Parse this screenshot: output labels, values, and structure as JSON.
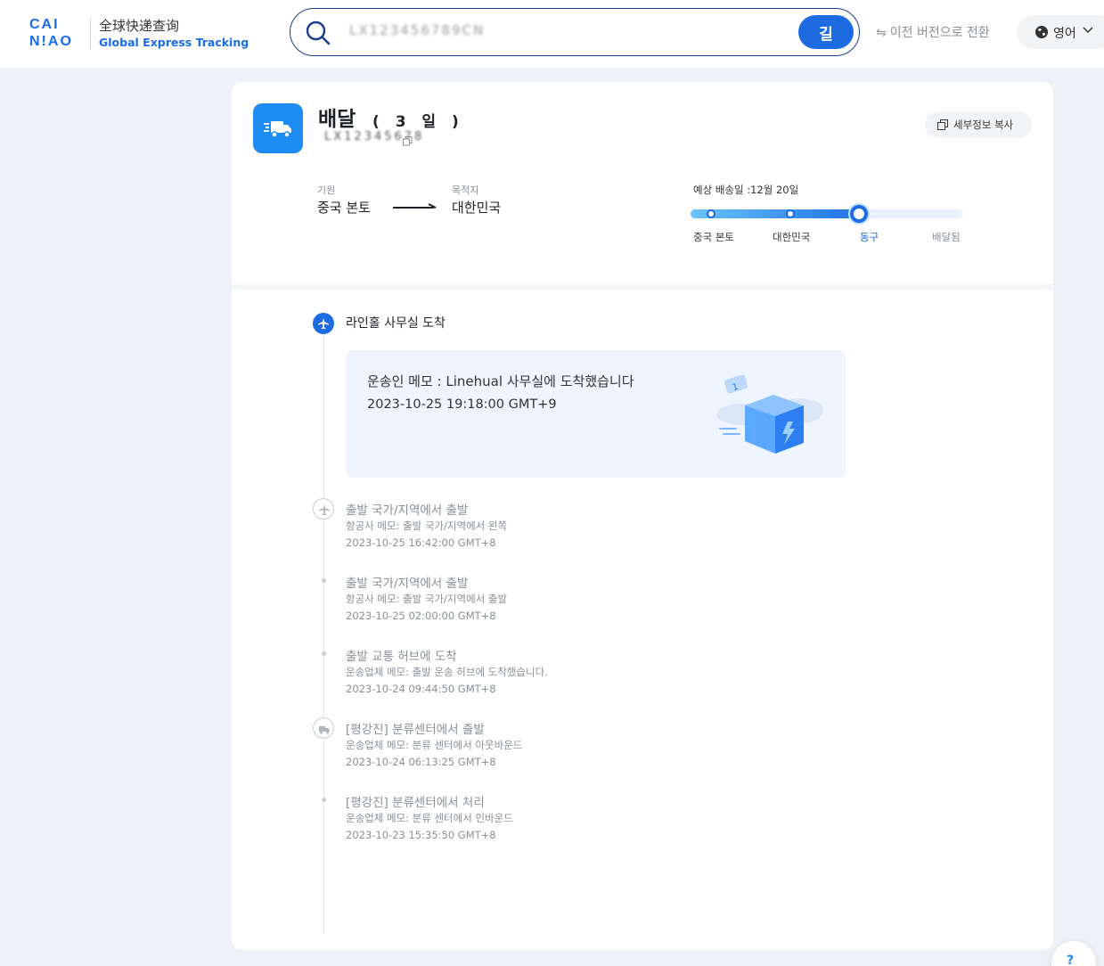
{
  "header": {
    "logo_cn": "全球快递查询",
    "logo_en": "Global Express Tracking",
    "search": {
      "value": "LX123456789CN",
      "button": "길"
    },
    "switch_old_version": "이전 버전으로 전환",
    "language": "영어"
  },
  "package": {
    "status": "배달",
    "days": "( 3 일 )",
    "tracking_number": "LX12345678",
    "copy_details": "세부정보 복사",
    "origin_label": "기원",
    "origin": "중국 본토",
    "destination_label": "목적지",
    "destination": "대한민국",
    "eta": "예상 배송일 :12월 20일",
    "progress": {
      "current_step": 2,
      "steps": [
        "중국 본토",
        "대한민국",
        "동구",
        "배달됨"
      ]
    }
  },
  "timeline": {
    "latest": {
      "title": "라인홀 사무실 도착",
      "desc": "운송인 메모 : Linehual 사무실에 도착했습니다",
      "time": "2023-10-25 19:18:00 GMT+9"
    },
    "events": [
      {
        "icon": "plane-icon",
        "title": "출발 국가/지역에서 출발",
        "desc": "항공사 메모: 출발 국가/지역에서 왼쪽",
        "time": "2023-10-25 16:42:00 GMT+8"
      },
      {
        "icon": "dot",
        "title": "출발 국가/지역에서 출발",
        "desc": "항공사 메모: 출발 국가/지역에서 출발",
        "time": "2023-10-25 02:00:00 GMT+8"
      },
      {
        "icon": "dot",
        "title": "출발 교통 허브에 도착",
        "desc": "운송업체 메모: 출발 운송 허브에 도착했습니다.",
        "time": "2023-10-24 09:44:50 GMT+8"
      },
      {
        "icon": "truck-icon",
        "title": "[평강진] 분류센터에서 출발",
        "desc": "운송업체 메모: 분류 센터에서 아웃바운드",
        "time": "2023-10-24 06:13:25 GMT+8"
      },
      {
        "icon": "dot",
        "title": "[평강진] 분류센터에서 처리",
        "desc": "운송업체 메모: 분류 센터에서 인바운드",
        "time": "2023-10-23 15:35:50 GMT+8"
      }
    ]
  },
  "colors": {
    "brand": "#1c6be0",
    "accent": "#1c8cf2",
    "muted": "#8a8f99"
  }
}
